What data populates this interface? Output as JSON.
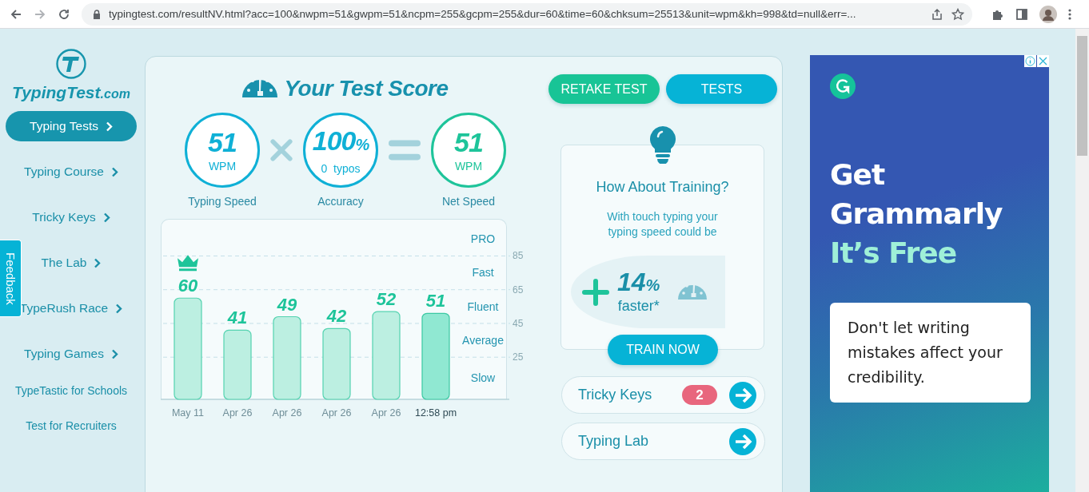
{
  "browser": {
    "url": "typingtest.com/resultNV.html?acc=100&nwpm=51&gwpm=51&ncpm=255&gcpm=255&dur=60&time=60&chksum=25513&unit=wpm&kh=998&td=null&err=..."
  },
  "sidebar": {
    "logo": "TypingTest",
    "logo_suffix": ".com",
    "items": [
      {
        "label": "Typing Tests",
        "selected": true
      },
      {
        "label": "Typing Course",
        "selected": false
      },
      {
        "label": "Tricky Keys",
        "selected": false
      },
      {
        "label": "The Lab",
        "selected": false
      },
      {
        "label": "TypeRush Race",
        "selected": false
      },
      {
        "label": "Typing Games",
        "selected": false
      }
    ],
    "links": [
      "TypeTastic for Schools",
      "Test for Recruiters"
    ],
    "feedback": "Feedback"
  },
  "score": {
    "title": "Your Test Score",
    "stats": [
      {
        "kind": "gross",
        "value": "51",
        "unit": "WPM",
        "caption": "Typing Speed"
      },
      {
        "kind": "accuracy",
        "value": "100",
        "suffix": "%",
        "unit": "0  typos",
        "caption": "Accuracy"
      },
      {
        "kind": "net",
        "value": "51",
        "unit": "WPM",
        "caption": "Net Speed"
      }
    ]
  },
  "chart": {
    "zones": [
      "PRO",
      "Fast",
      "Fluent",
      "Average",
      "Slow"
    ],
    "chart_data": {
      "type": "bar",
      "categories": [
        "May 11",
        "Apr 26",
        "Apr 26",
        "Apr 26",
        "Apr 26",
        "12:58 pm"
      ],
      "values": [
        60,
        41,
        49,
        42,
        52,
        51
      ],
      "ylim": [
        0,
        107
      ],
      "yticks": [
        25,
        45,
        65,
        85
      ],
      "grid": true,
      "data_labels": true
    }
  },
  "actions": [
    {
      "label": "RETAKE TEST",
      "kind": "retake"
    },
    {
      "label": "TESTS",
      "kind": "tests"
    }
  ],
  "training": {
    "title": "How About Training?",
    "text": "With touch typing your typing speed could be",
    "gain": "14",
    "gain_suffix": "%",
    "gain_label": "faster*",
    "button": "TRAIN NOW"
  },
  "links": [
    {
      "label": "Tricky Keys",
      "badge": "2"
    },
    {
      "label": "Typing Lab"
    }
  ],
  "ad": {
    "headline": [
      "Get",
      "Grammarly"
    ],
    "highlight": "It’s Free",
    "body": "Don't let writing mistakes affect your credibility."
  }
}
